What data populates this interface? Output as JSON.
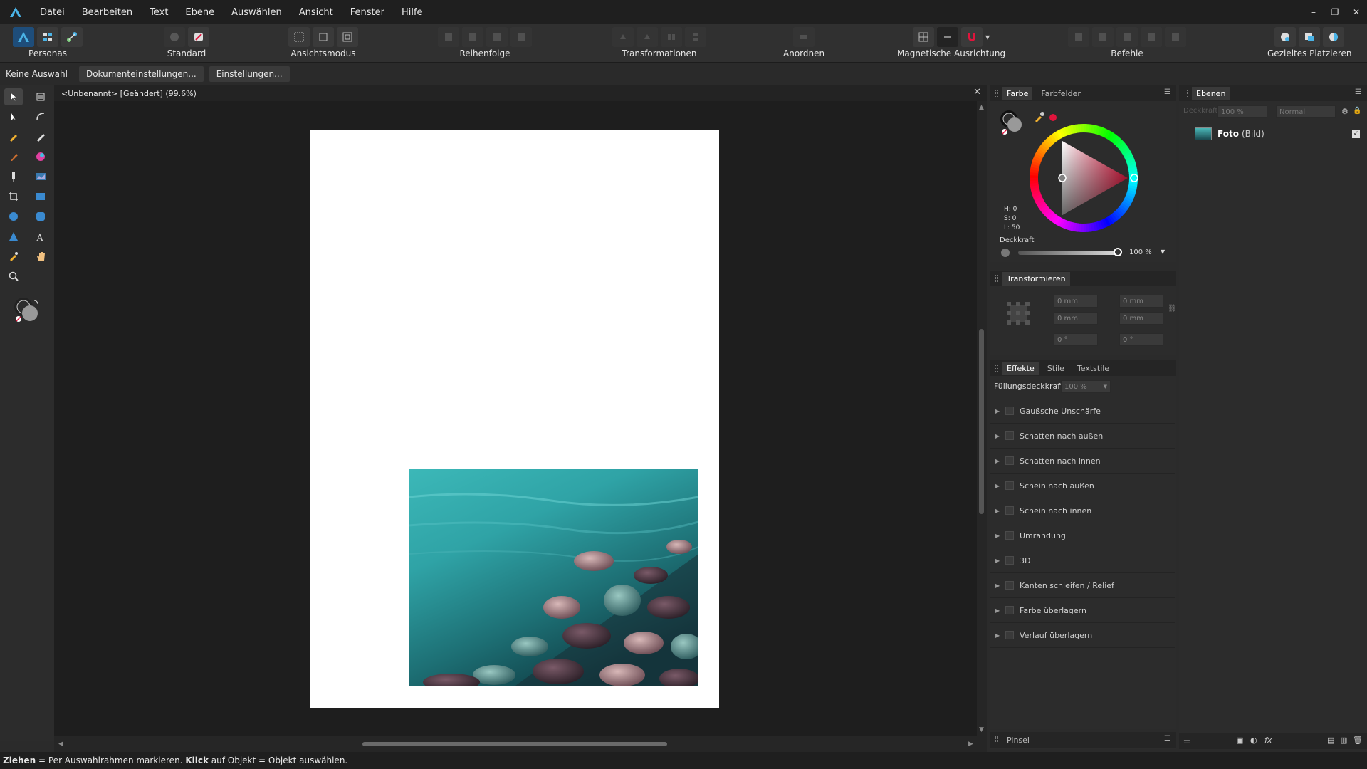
{
  "menu": {
    "items": [
      "Datei",
      "Bearbeiten",
      "Text",
      "Ebene",
      "Auswählen",
      "Ansicht",
      "Fenster",
      "Hilfe"
    ]
  },
  "window_controls": {
    "minimize": "–",
    "restore": "❐",
    "close": "✕"
  },
  "toolbar": {
    "personas_label": "Personas",
    "standard_label": "Standard",
    "ansichtsmodus_label": "Ansichtsmodus",
    "reihenfolge_label": "Reihenfolge",
    "transformationen_label": "Transformationen",
    "anordnen_label": "Anordnen",
    "magnetische_label": "Magnetische Ausrichtung",
    "befehle_label": "Befehle",
    "gezieltes_label": "Gezieltes Platzieren"
  },
  "contextbar": {
    "selection_label": "Keine Auswahl",
    "doc_settings_label": "Dokumenteinstellungen...",
    "settings_label": "Einstellungen..."
  },
  "document": {
    "tab_title": "<Unbenannt> [Geändert] (99.6%)",
    "close": "✕"
  },
  "color_panel": {
    "tabs": [
      "Farbe",
      "Farbfelder"
    ],
    "h_label": "H: 0",
    "s_label": "S: 0",
    "l_label": "L: 50",
    "opacity_label": "Deckkraft",
    "opacity_value": "100 %",
    "opacity_fraction": 1.0,
    "colors": {
      "primary": "#e0143c",
      "accent": "#1e4d7a"
    }
  },
  "transform_panel": {
    "title": "Transformieren",
    "x_value": "0 mm",
    "y_value": "0 mm",
    "w_value": "0 mm",
    "h_value": "0 mm",
    "r_value": "0 °",
    "s_value": "0 °"
  },
  "effects_panel": {
    "tabs": [
      "Effekte",
      "Stile",
      "Textstile"
    ],
    "fill_opacity_label": "Füllungsdeckkraft:",
    "fill_opacity_value": "100 %",
    "effects": [
      "Gaußsche Unschärfe",
      "Schatten nach außen",
      "Schatten nach innen",
      "Schein nach außen",
      "Schein nach innen",
      "Umrandung",
      "3D",
      "Kanten schleifen / Relief",
      "Farbe überlagern",
      "Verlauf überlagern"
    ]
  },
  "brush_panel": {
    "title": "Pinsel"
  },
  "layers_panel": {
    "title": "Ebenen",
    "opacity_label": "Deckkraft:",
    "opacity_value": "100 %",
    "blend_mode": "Normal",
    "layer_name": "Foto",
    "layer_type": "(Bild)"
  },
  "status": {
    "drag_bold": "Ziehen",
    "drag_text": " = Per Auswahlrahmen markieren. ",
    "click_bold": "Klick",
    "click_text": " auf Objekt = Objekt auswählen."
  }
}
